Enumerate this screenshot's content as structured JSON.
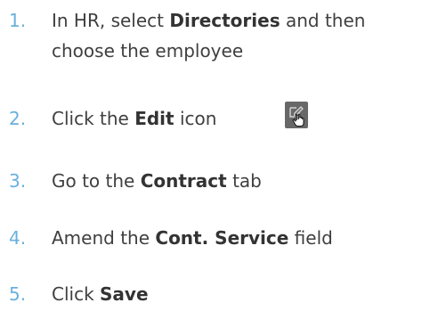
{
  "steps": [
    {
      "number": "1.",
      "pre": "In HR, select ",
      "bold": "Directories",
      "post": " and then",
      "line2": "choose the employee"
    },
    {
      "number": "2.",
      "pre": "Click the ",
      "bold": "Edit",
      "post": " icon"
    },
    {
      "number": "3.",
      "pre": "Go to the ",
      "bold": "Contract",
      "post": " tab"
    },
    {
      "number": "4.",
      "pre": "Amend the ",
      "bold": "Cont. Service",
      "post": " field"
    },
    {
      "number": "5.",
      "pre": "Click ",
      "bold": "Save",
      "post": ""
    }
  ],
  "edit_icon": {
    "icon": "edit-icon",
    "cursor": "hand-pointer-icon",
    "background": "#686868"
  },
  "colors": {
    "number": "#6ab0dd",
    "text": "#3f3f3f"
  }
}
